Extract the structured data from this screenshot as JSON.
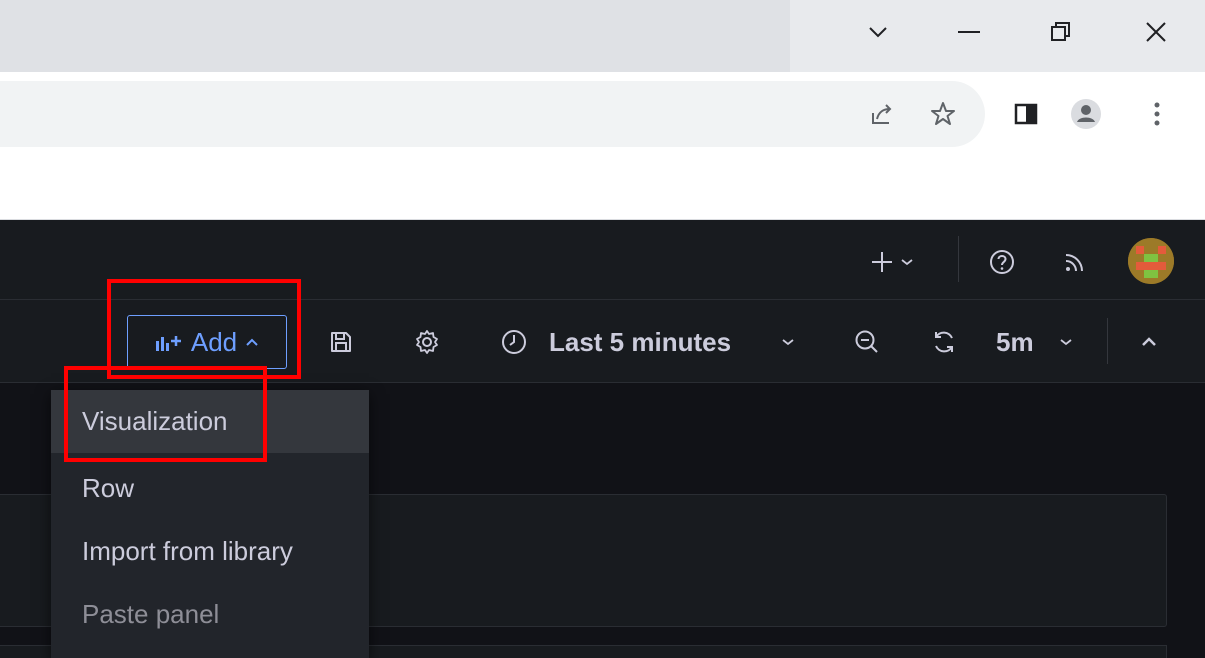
{
  "browser": {
    "window_controls": {
      "tab_search_icon": "chevron-down-icon",
      "minimize_icon": "minimize-icon",
      "restore_icon": "restore-icon",
      "close_icon": "close-icon"
    },
    "toolbar_icons": [
      "share-icon",
      "star-icon",
      "side-panel-icon",
      "profile-icon",
      "kebab-menu-icon"
    ]
  },
  "grafana_nav": {
    "icons": [
      "plus-icon",
      "help-icon",
      "rss-icon",
      "avatar"
    ]
  },
  "dashboard_toolbar": {
    "add_label": "Add",
    "time_range": "Last 5 minutes",
    "refresh_interval": "5m"
  },
  "add_menu": {
    "items": [
      {
        "label": "Visualization",
        "state": "highlighted"
      },
      {
        "label": "Row",
        "state": "normal"
      },
      {
        "label": "Import from library",
        "state": "normal"
      },
      {
        "label": "Paste panel",
        "state": "disabled"
      }
    ]
  },
  "colors": {
    "accent_blue": "#6e9fff",
    "annotation_red": "#ff0000",
    "panel_bg": "#181b1f",
    "canvas_bg": "#111217"
  }
}
